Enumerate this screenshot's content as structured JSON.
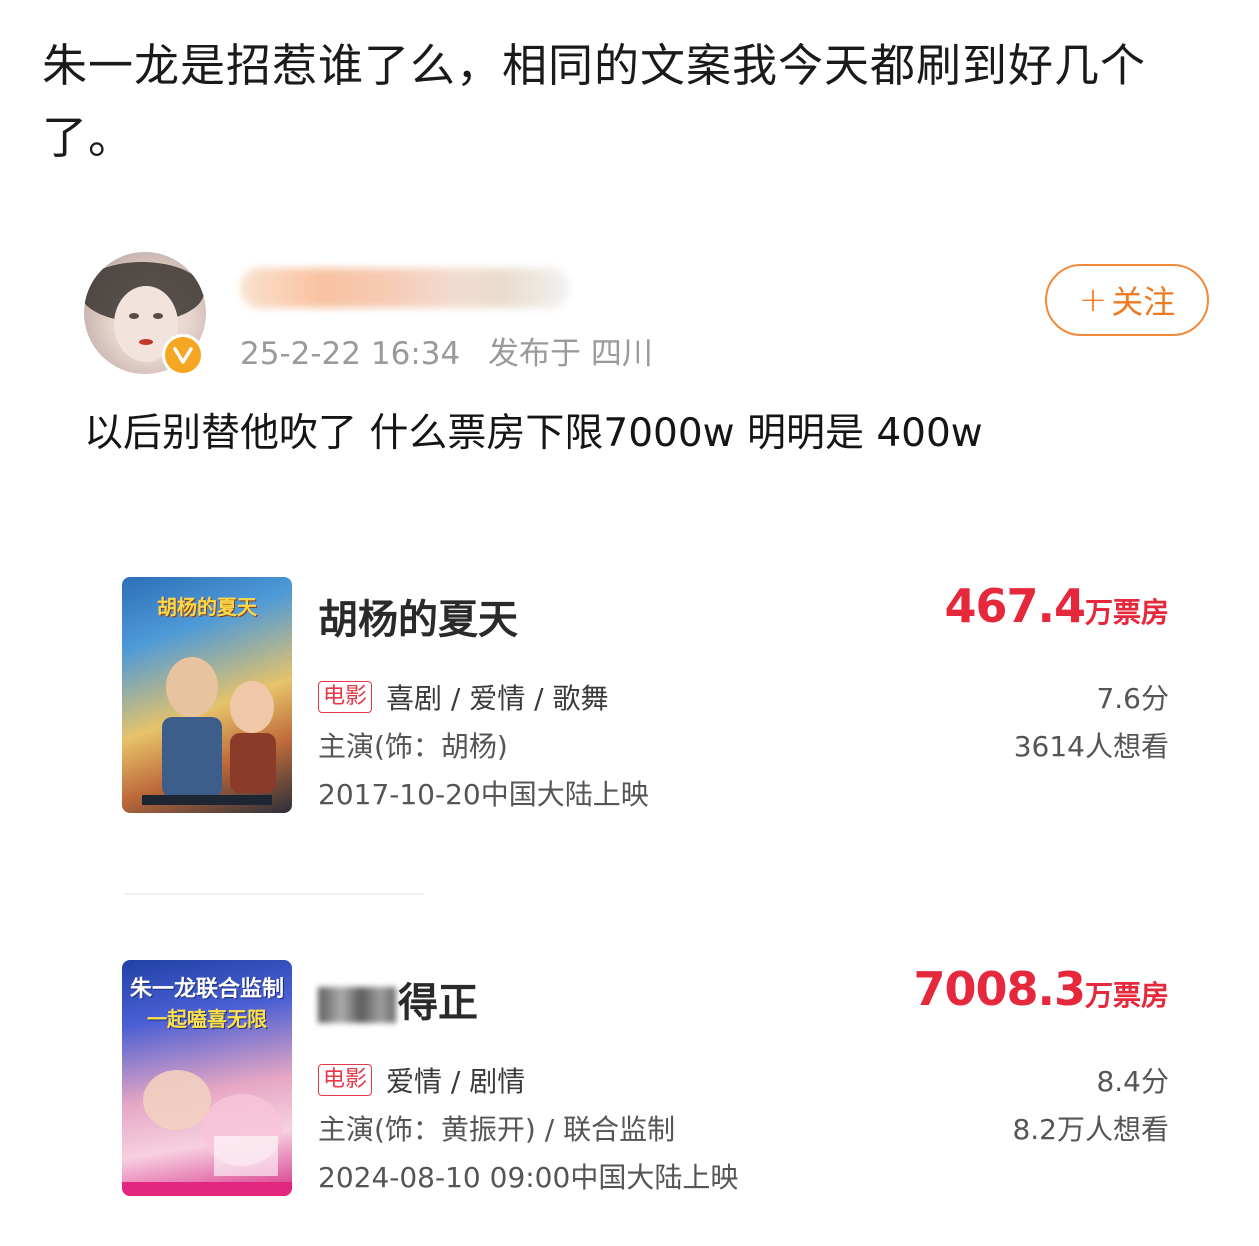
{
  "headline": "朱一龙是招惹谁了么，相同的文案我今天都刷到好几个了。",
  "post": {
    "meta_time": "25-2-22 16:34",
    "meta_location": "发布于 四川",
    "follow_label": "关注",
    "text": "以后别替他吹了 什么票房下限7000w 明明是 400w"
  },
  "movies": [
    {
      "title": "胡杨的夏天",
      "title_visible": "胡杨的夏天",
      "poster_caption": "胡杨的夏天",
      "box_value": "467.4",
      "box_unit": "万票房",
      "tag": "电影",
      "genres": "喜剧 / 爱情 / 歌舞",
      "cast": "主演(饰：胡杨)",
      "release": "2017-10-20中国大陆上映",
      "score": "7.6分",
      "want": "3614人想看"
    },
    {
      "title": "得正",
      "title_visible": "得正",
      "poster_caption": "朱一龙联合监制",
      "poster_caption2": "一起嗑喜无限",
      "box_value": "7008.3",
      "box_unit": "万票房",
      "tag": "电影",
      "genres": "爱情 / 剧情",
      "cast": "主演(饰：黄振开) / 联合监制",
      "release": "2024-08-10 09:00中国大陆上映",
      "score": "8.4分",
      "want": "8.2万人想看"
    }
  ],
  "icons": {
    "verified_badge": "verified-badge-icon",
    "follow_plus": "plus-icon"
  },
  "colors": {
    "accent": "#e6283c",
    "follow": "#f07a22",
    "meta": "#9a9a9a"
  }
}
